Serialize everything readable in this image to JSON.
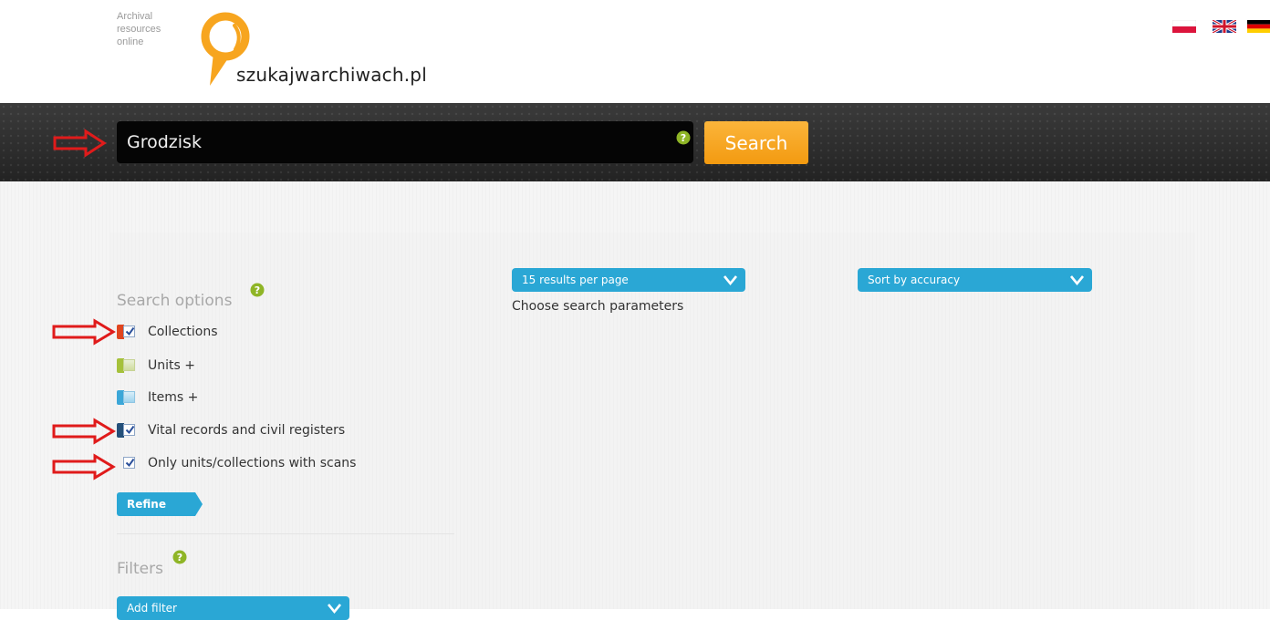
{
  "header": {
    "tagline": [
      "Archival",
      "resources",
      "online"
    ],
    "site_name": "szukajwarchiwach.pl",
    "languages": [
      {
        "code": "pl",
        "icon": "flag-poland-icon"
      },
      {
        "code": "en",
        "icon": "flag-uk-icon"
      },
      {
        "code": "de",
        "icon": "flag-germany-icon"
      }
    ]
  },
  "search": {
    "query": "Grodzisk",
    "button_label": "Search"
  },
  "results_controls": {
    "per_page_label": "15 results per page",
    "sort_label": "Sort by accuracy",
    "hint": "Choose search parameters"
  },
  "search_options": {
    "title": "Search options",
    "items": [
      {
        "label": "Collections",
        "checked": true,
        "swatch": "#e0451f"
      },
      {
        "label": "Units +",
        "checked": false,
        "swatch": "#a5c13a"
      },
      {
        "label": "Items +",
        "checked": false,
        "swatch": "#3ba7d8"
      },
      {
        "label": "Vital records and civil registers",
        "checked": true,
        "swatch": "#24507a"
      },
      {
        "label": "Only units/collections with scans",
        "checked": true,
        "swatch": ""
      }
    ],
    "refine_label": "Refine"
  },
  "filters": {
    "title": "Filters",
    "add_filter_label": "Add filter"
  },
  "colors": {
    "accent_blue": "#2aa7d5",
    "search_orange": "#f7a51f",
    "annotation_red": "#e01b1b"
  }
}
